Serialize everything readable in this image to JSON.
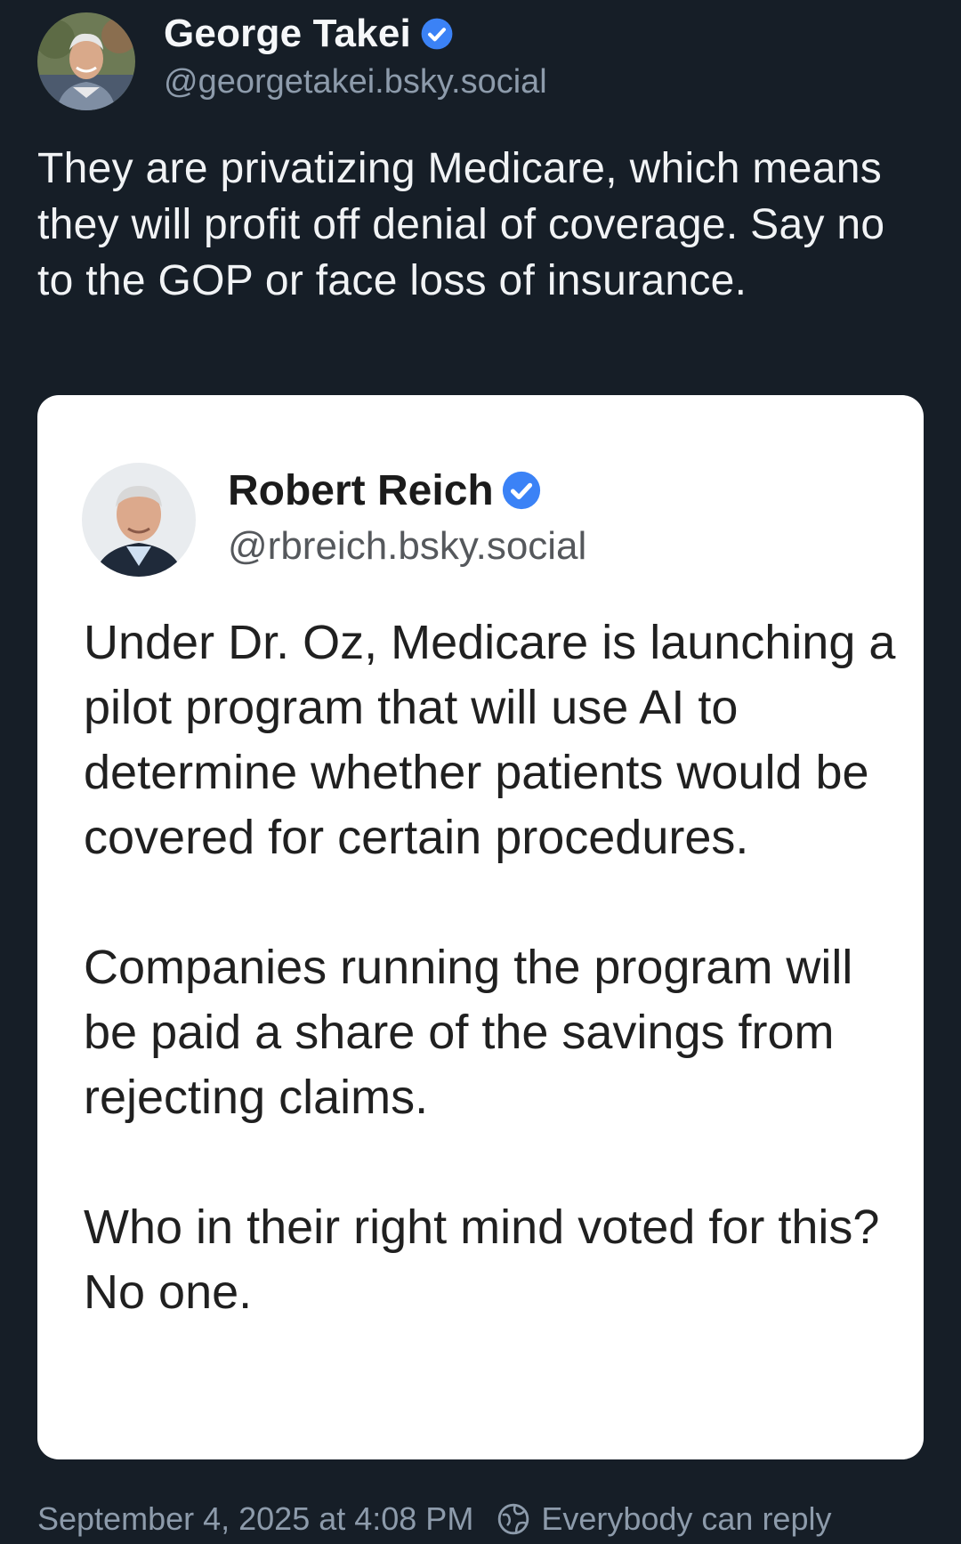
{
  "post": {
    "author": {
      "display_name": "George Takei",
      "handle": "@georgetakei.bsky.social",
      "verified": true,
      "avatar_icon": "user-photo"
    },
    "text": "They are privatizing Medicare, which means they will profit off denial of coverage. Say no to the GOP or face loss of insurance.",
    "timestamp": "September 4, 2025 at 4:08 PM",
    "reply_setting": "Everybody can reply"
  },
  "quote": {
    "author": {
      "display_name": "Robert Reich",
      "handle": "@rbreich.bsky.social",
      "verified": true,
      "avatar_icon": "user-photo"
    },
    "paragraphs": [
      "Under Dr. Oz, Medicare is launching a pilot program that will use AI to determine whether patients would be covered for certain procedures.",
      "Companies running the program will be paid a share of the savings from rejecting claims.",
      "Who in their right mind voted for this? No one."
    ]
  },
  "colors": {
    "background": "#161e27",
    "verified_badge": "#3b82f6",
    "muted_text": "#8d9bab",
    "card_background": "#ffffff"
  }
}
